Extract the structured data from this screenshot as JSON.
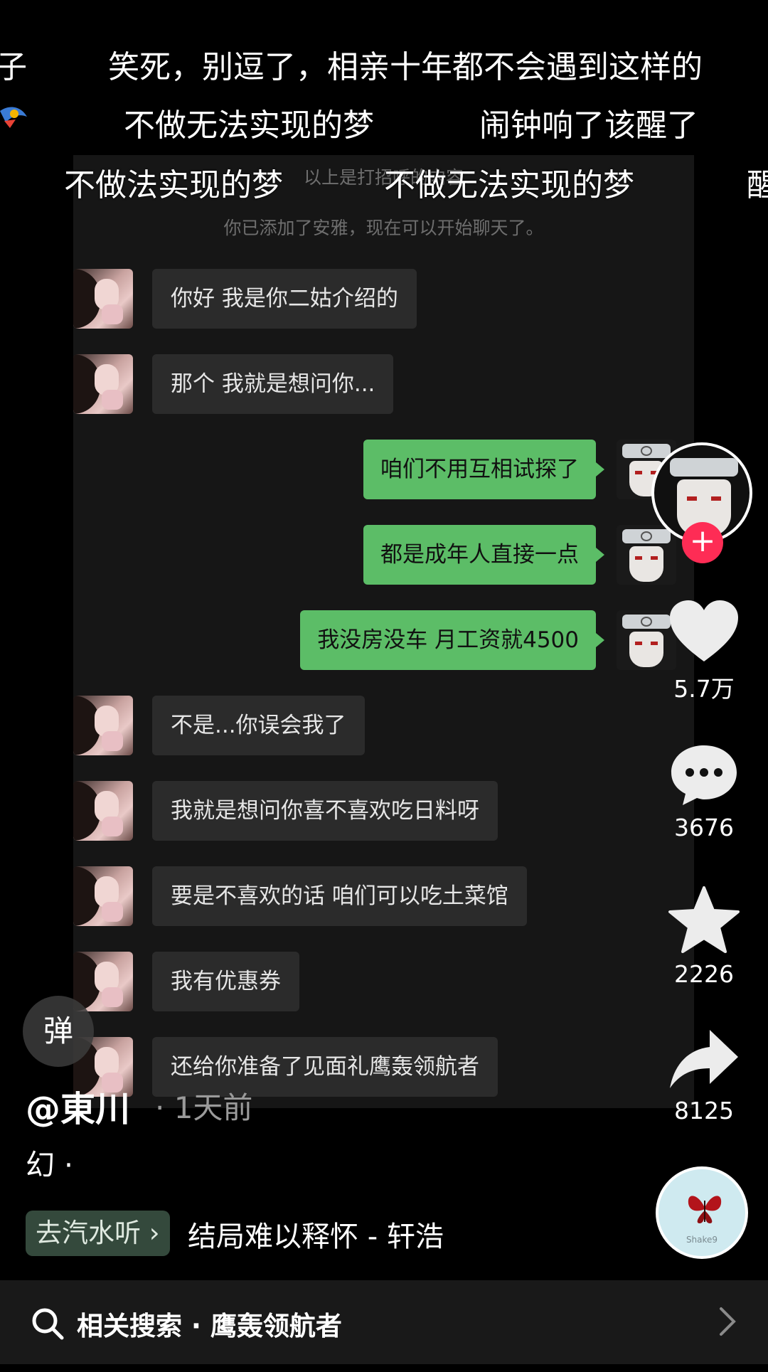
{
  "danmaku": [
    "子",
    "笑死，别逗了，相亲十年都不会遇到这样的",
    "不做无法实现的梦",
    "闹钟响了该醒了",
    "不做法实现的梦",
    "不做无法实现的梦",
    "醒"
  ],
  "chat": {
    "system_top": "以上是打招呼的内容",
    "system_added": "你已添加了安雅，现在可以开始聊天了。",
    "messages": [
      {
        "side": "left",
        "text": "你好 我是你二姑介绍的"
      },
      {
        "side": "left",
        "text": "那个 我就是想问你..."
      },
      {
        "side": "right",
        "text": "咱们不用互相试探了"
      },
      {
        "side": "right",
        "text": "都是成年人直接一点"
      },
      {
        "side": "right",
        "text": "我没房没车 月工资就4500"
      },
      {
        "side": "left",
        "text": "不是...你误会我了"
      },
      {
        "side": "left",
        "text": "我就是想问你喜不喜欢吃日料呀"
      },
      {
        "side": "left",
        "text": "要是不喜欢的话 咱们可以吃土菜馆"
      },
      {
        "side": "left",
        "text": "我有优惠券"
      },
      {
        "side": "left",
        "text": "还给你准备了见面礼鹰轰领航者"
      }
    ]
  },
  "rail": {
    "likes": "5.7万",
    "comments": "3676",
    "favorites": "2226",
    "shares": "8125",
    "follow_symbol": "+"
  },
  "danmu_toggle_label": "弹",
  "post": {
    "author": "@東川",
    "time": "· 1天前",
    "description": "幻 ·"
  },
  "music": {
    "chip_label": "去汽水听 ›",
    "title": "结局难以释怀 - 轩浩",
    "disc_label": "Shake9"
  },
  "search": {
    "label": "相关搜索 · 鹰轰领航者"
  },
  "colors": {
    "bubble_green": "#5cbd67",
    "bubble_dark": "#2b2b2b",
    "follow_red": "#fe2c55",
    "music_chip": "#34493c"
  },
  "icons": [
    "heart-icon",
    "comment-icon",
    "star-icon",
    "share-icon",
    "search-icon",
    "chevron-right-icon",
    "butterfly-icon"
  ]
}
